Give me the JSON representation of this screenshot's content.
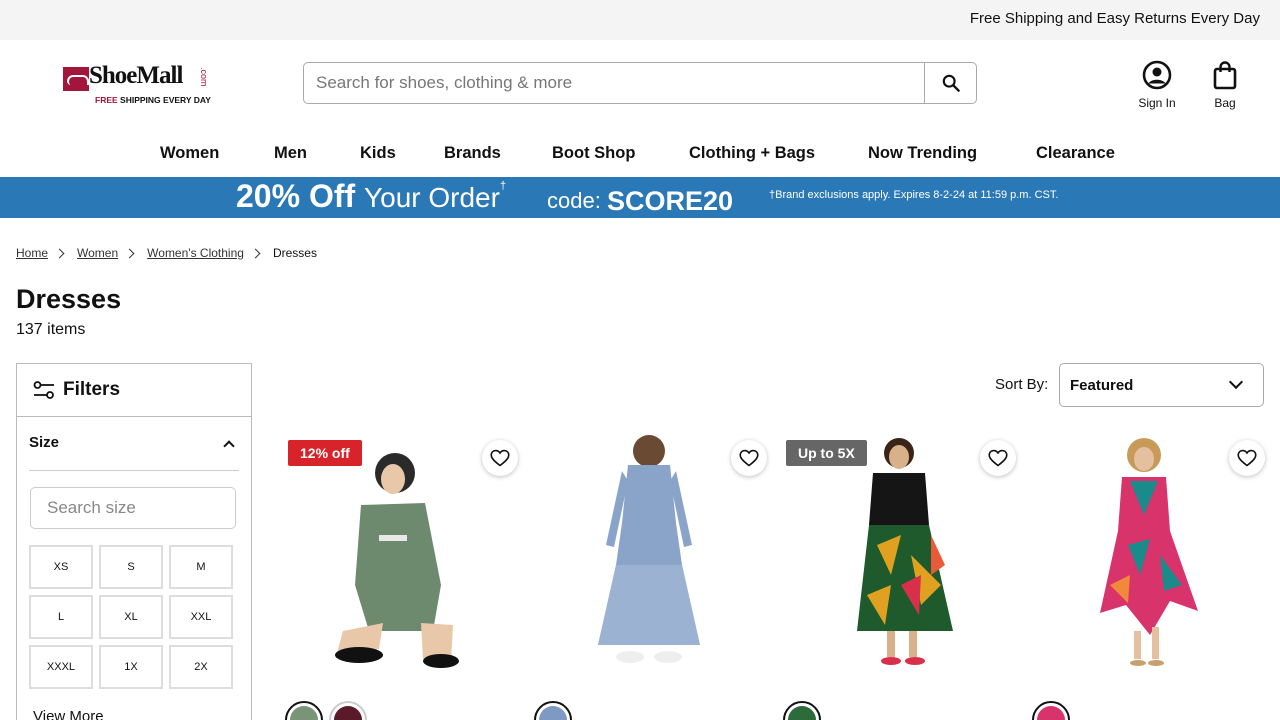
{
  "topbar": {
    "message": "Free Shipping and Easy Returns Every Day"
  },
  "logo": {
    "name": "ShoeMall",
    "com": ".com",
    "tag_free": "FREE",
    "tag_rest": "SHIPPING EVERY DAY"
  },
  "search": {
    "placeholder": "Search for shoes, clothing & more"
  },
  "header": {
    "signin_label": "Sign In",
    "bag_label": "Bag"
  },
  "nav": [
    "Women",
    "Men",
    "Kids",
    "Brands",
    "Boot Shop",
    "Clothing + Bags",
    "Now Trending",
    "Clearance"
  ],
  "promo": {
    "offer_bold": "20% Off",
    "offer_rest": "Your Order",
    "dagger": "†",
    "code_label": "code:",
    "code": "SCORE20",
    "fine_print": "†Brand exclusions apply. Expires 8-2-24 at 11:59 p.m. CST."
  },
  "breadcrumb": [
    "Home",
    "Women",
    "Women's Clothing",
    "Dresses"
  ],
  "page": {
    "title": "Dresses",
    "count": "137 items"
  },
  "filters": {
    "title": "Filters",
    "size_heading": "Size",
    "search_placeholder": "Search size",
    "sizes": [
      "XS",
      "S",
      "M",
      "L",
      "XL",
      "XXL",
      "XXXL",
      "1X",
      "2X"
    ],
    "view_more": "View More"
  },
  "sort": {
    "label": "Sort By:",
    "value": "Featured"
  },
  "products": [
    {
      "badge": "12% off",
      "badge_color": "#d8232a",
      "dress_color": "#6e8a6e",
      "swatches": [
        "#7a9478",
        "#5a1a2a"
      ]
    },
    {
      "badge": "",
      "dress_color": "#8aa3c8",
      "swatches": [
        "#7f9ac2"
      ]
    },
    {
      "badge": "Up to 5X",
      "badge_color": "#666666",
      "dress_color": "#1a1a1a",
      "swatches": [
        "#2e6b3a"
      ]
    },
    {
      "badge": "",
      "dress_color": "#d9336b",
      "swatches": [
        "#d9336b"
      ]
    }
  ],
  "colors": {
    "brand": "#a4153c",
    "promo_bg": "#2b78b6"
  }
}
